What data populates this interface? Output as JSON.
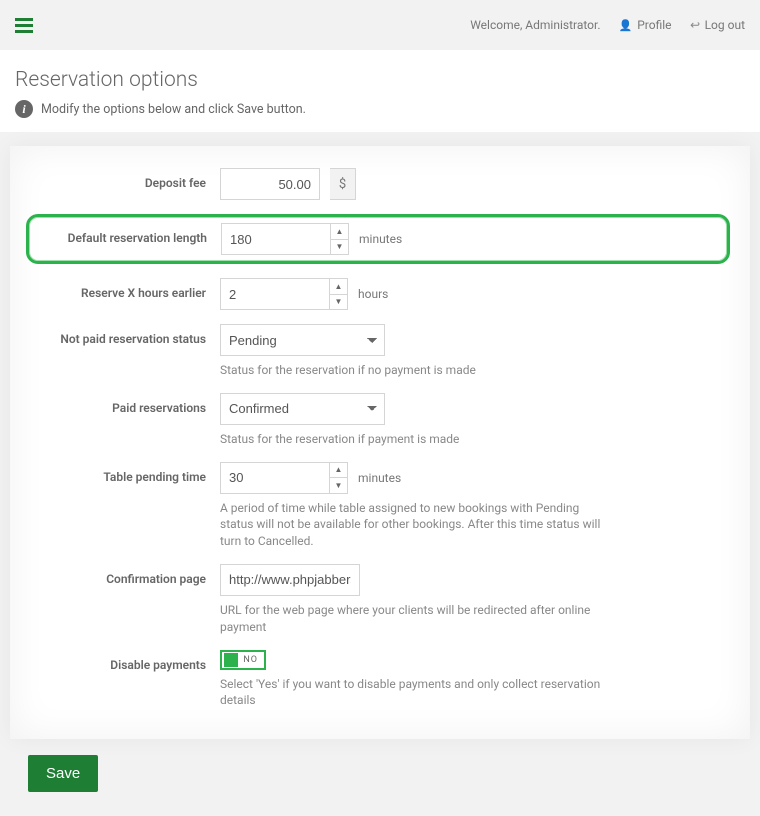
{
  "topbar": {
    "welcome": "Welcome, Administrator.",
    "profile": "Profile",
    "logout": "Log out"
  },
  "page": {
    "title": "Reservation options",
    "subtitle": "Modify the options below and click Save button."
  },
  "form": {
    "deposit": {
      "label": "Deposit fee",
      "value": "50.00",
      "currency": "$"
    },
    "default_length": {
      "label": "Default reservation length",
      "value": "180",
      "unit": "minutes"
    },
    "reserve_earlier": {
      "label": "Reserve X hours earlier",
      "value": "2",
      "unit": "hours"
    },
    "not_paid_status": {
      "label": "Not paid reservation status",
      "value": "Pending",
      "help": "Status for the reservation if no payment is made"
    },
    "paid_status": {
      "label": "Paid reservations",
      "value": "Confirmed",
      "help": "Status for the reservation if payment is made"
    },
    "pending_time": {
      "label": "Table pending time",
      "value": "30",
      "unit": "minutes",
      "help": "A period of time while table assigned to new bookings with Pending status will not be available for other bookings. After this time status will turn to Cancelled."
    },
    "confirmation": {
      "label": "Confirmation page",
      "value": "http://www.phpjabbers",
      "help": "URL for the web page where your clients will be redirected after online payment"
    },
    "disable_payments": {
      "label": "Disable payments",
      "state": "NO",
      "help": "Select 'Yes' if you want to disable payments and only collect reservation details"
    }
  },
  "save_label": "Save"
}
